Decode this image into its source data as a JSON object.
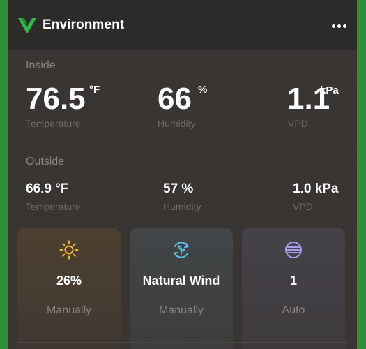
{
  "header": {
    "title": "Environment",
    "logo_icon": "v-leaf-logo-icon",
    "menu_icon": "more-horizontal-icon",
    "brand_color": "#2eb84a"
  },
  "inside": {
    "label": "Inside",
    "temperature": {
      "value": "76.5",
      "unit": "°F",
      "label": "Temperature"
    },
    "humidity": {
      "value": "66",
      "unit": "%",
      "label": "Humidity"
    },
    "vpd": {
      "value": "1.1",
      "unit": "kPa",
      "label": "VPD"
    }
  },
  "outside": {
    "label": "Outside",
    "temperature": {
      "value": "66.9 °F",
      "label": "Temperature"
    },
    "humidity": {
      "value": "57 %",
      "label": "Humidity"
    },
    "vpd": {
      "value": "1.0 kPa",
      "label": "VPD"
    }
  },
  "controls": [
    {
      "icon": "sun-icon",
      "value": "26%",
      "mode": "Manually",
      "color": "#f2b630"
    },
    {
      "icon": "natural-wind-icon",
      "value": "Natural Wind",
      "mode": "Manually",
      "color": "#5bc0e8"
    },
    {
      "icon": "circulation-fan-icon",
      "value": "1",
      "mode": "Auto",
      "color": "#a99be8"
    }
  ]
}
